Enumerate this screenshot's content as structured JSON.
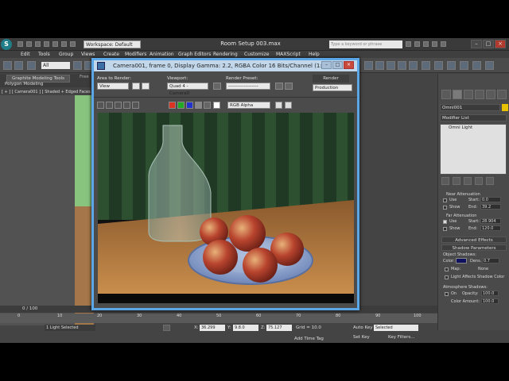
{
  "app": {
    "title": "Room Setup 003.max",
    "logo": "S",
    "workspace": "Workspace: Default",
    "search_placeholder": "Type a keyword or phrase",
    "window_controls": [
      "–",
      "□",
      "×"
    ]
  },
  "menubar": {
    "items": [
      "Edit",
      "Tools",
      "Group",
      "Views",
      "Create",
      "Modifiers",
      "Animation",
      "Graph Editors",
      "Rendering",
      "Customize",
      "MAXScript",
      "Help"
    ]
  },
  "toolbar": {
    "selection_filter": "All"
  },
  "ribbon": {
    "tab_active": "Graphite Modeling Tools",
    "tab_next": "Free",
    "sub_label": "Polygon Modeling"
  },
  "viewport": {
    "label": "[ + ] [ Camera001 ] [ Shaded + Edged Faces ]"
  },
  "render_window": {
    "title": "Camera001, frame 0, Display Gamma: 2.2, RGBA Color 16 Bits/Channel (1:1)",
    "area_to_render_label": "Area to Render:",
    "area_to_render_value": "View",
    "viewport_label": "Viewport:",
    "viewport_value": "Quad 4 - Camera0",
    "render_preset_label": "Render Preset:",
    "render_preset_value": "-------------------",
    "render_button": "Render",
    "production_value": "Production",
    "channel_value": "RGB Alpha"
  },
  "right_panel": {
    "object_name": "Omni001",
    "modifier_list": "Modifier List",
    "stack_item": "Omni Light",
    "near_attenuation_label": "Near Attenuation",
    "near_use": "Use",
    "near_show": "Show",
    "near_start_label": "Start:",
    "near_start_value": "0.0",
    "near_end_label": "End:",
    "near_end_value": "39.2",
    "far_attenuation_label": "Far Attenuation",
    "far_use": "Use",
    "far_show": "Show",
    "far_start_label": "Start:",
    "far_start_value": "28.904",
    "far_end_label": "End:",
    "far_end_value": "120.0",
    "advanced_effects": "Advanced Effects",
    "shadow_parameters": "Shadow Parameters",
    "object_shadows": "Object Shadows:",
    "color_label": "Color:",
    "dens_label": "Dens.",
    "dens_value": "0.7",
    "map_label": "Map:",
    "map_value": "None",
    "light_affects": "Light Affects Shadow Color",
    "atmosphere_shadows": "Atmosphere Shadows:",
    "on_label": "On",
    "opacity_label": "Opacity:",
    "opacity_value": "100.0",
    "color_amount_label": "Color Amount:",
    "color_amount_value": "100.0"
  },
  "timeline": {
    "frame_label": "0 / 100",
    "ticks": [
      "0",
      "10",
      "20",
      "30",
      "40",
      "50",
      "60",
      "70",
      "80",
      "90",
      "100"
    ]
  },
  "statusbar": {
    "selection_status": "1 Light Selected",
    "x_label": "X:",
    "x_value": "36.299",
    "y_label": "Y:",
    "y_value": "9.8.0",
    "z_label": "Z:",
    "z_value": "75.127",
    "grid_label": "Grid = 10.0",
    "auto_key": "Auto Key",
    "selected_value": "Selected",
    "set_key": "Set Key",
    "key_filters": "Key Filters...",
    "add_time_tag": "Add Time Tag"
  }
}
